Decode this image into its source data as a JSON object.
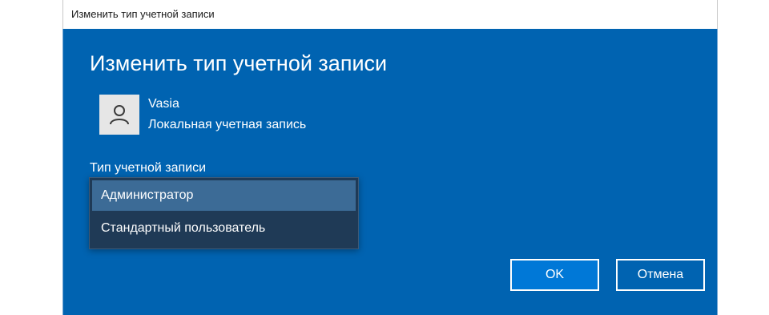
{
  "window": {
    "title": "Изменить тип учетной записи"
  },
  "dialog": {
    "heading": "Изменить тип учетной записи",
    "user": {
      "name": "Vasia",
      "account_kind": "Локальная учетная запись",
      "avatar_icon": "user-icon"
    },
    "account_type_label": "Тип учетной записи",
    "account_type_options": [
      "Администратор",
      "Стандартный пользователь"
    ],
    "selected_option": "Администратор",
    "buttons": {
      "ok": "OK",
      "cancel": "Отмена"
    }
  },
  "colors": {
    "dialog_bg": "#0063b1",
    "dropdown_bg": "#1f3a56",
    "selected_bg": "#3c6b96",
    "ok_bg": "#0078d7"
  }
}
